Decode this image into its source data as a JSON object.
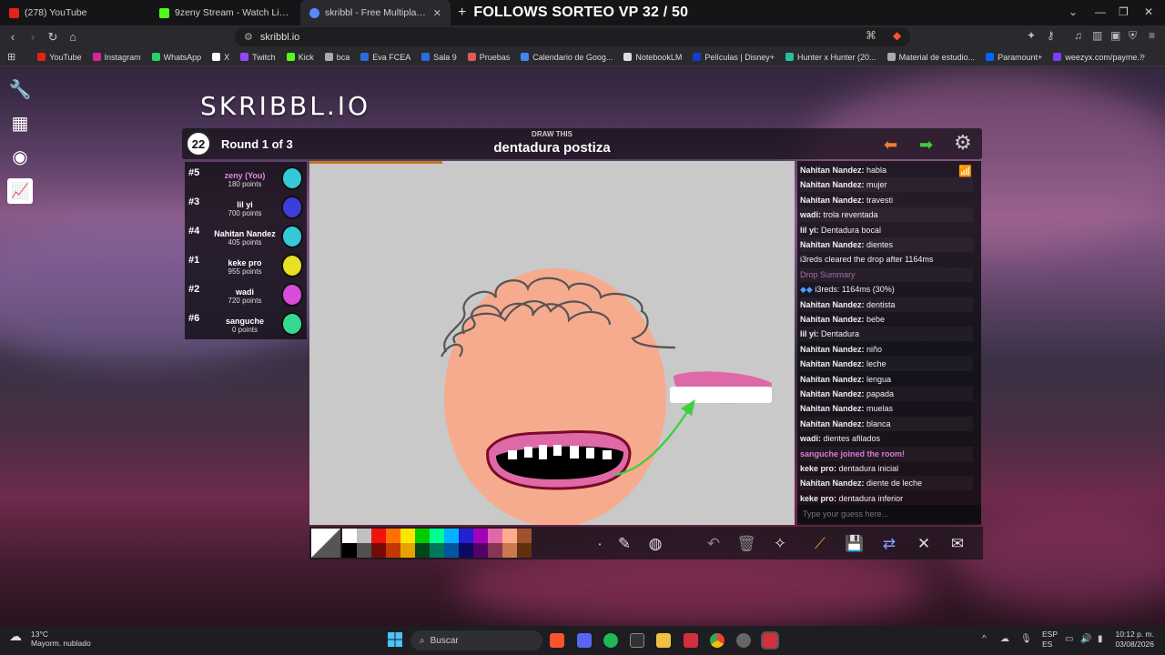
{
  "browser": {
    "tabs": [
      {
        "title": "(278) YouTube",
        "favicon_color": "#e62117"
      },
      {
        "title": "9zeny Stream - Watch Live on Kick",
        "favicon_color": "#53fc18"
      },
      {
        "title": "skribbl - Free Multiplayer Drawing",
        "favicon_color": "#5b87ff"
      }
    ],
    "overlay_title": "FOLLOWS SORTEO VP 32 / 50",
    "url": "skribbl.io",
    "bookmarks": [
      {
        "label": "YouTube",
        "color": "#e62117"
      },
      {
        "label": "Instagram",
        "color": "#d6249f"
      },
      {
        "label": "WhatsApp",
        "color": "#25d366"
      },
      {
        "label": "X",
        "color": "#ffffff"
      },
      {
        "label": "Twitch",
        "color": "#9146ff"
      },
      {
        "label": "Kick",
        "color": "#53fc18"
      },
      {
        "label": "bca",
        "color": "#aaaaaa"
      },
      {
        "label": "Eva FCEA",
        "color": "#2b6de0"
      },
      {
        "label": "Sala 9",
        "color": "#2b6de0"
      },
      {
        "label": "Pruebas",
        "color": "#e05a5a"
      },
      {
        "label": "Calendario de Goog...",
        "color": "#4285f4"
      },
      {
        "label": "NotebookLM",
        "color": "#dddddd"
      },
      {
        "label": "Películas | Disney+",
        "color": "#113ccf"
      },
      {
        "label": "Hunter x Hunter (20...",
        "color": "#1ec39e"
      },
      {
        "label": "Material de estudio...",
        "color": "#aaaaaa"
      },
      {
        "label": "Paramount+",
        "color": "#0064ff"
      },
      {
        "label": "weezyx.com/payme...",
        "color": "#7d3cff"
      }
    ]
  },
  "game": {
    "logo": "SKRIBBL.IO",
    "timer": "22",
    "round": "Round 1 of 3",
    "draw_this_label": "DRAW THIS",
    "word": "dentadura postiza",
    "players": [
      {
        "rank": "#5",
        "name": "zeny (You)",
        "points": "180 points",
        "you": true,
        "color": "#35c8d8"
      },
      {
        "rank": "#3",
        "name": "lil yi",
        "points": "700 points",
        "you": false,
        "color": "#3d3dd8"
      },
      {
        "rank": "#4",
        "name": "Nahitan Nandez",
        "points": "405 points",
        "you": false,
        "color": "#35c8d8"
      },
      {
        "rank": "#1",
        "name": "keke pro",
        "points": "955 points",
        "you": false,
        "color": "#e8e020"
      },
      {
        "rank": "#2",
        "name": "wadi",
        "points": "720 points",
        "you": false,
        "color": "#d84cd8"
      },
      {
        "rank": "#6",
        "name": "sanguche",
        "points": "0 points",
        "you": false,
        "color": "#35d890"
      }
    ],
    "chat": [
      {
        "user": "Nahitan Nandez",
        "text": "habla"
      },
      {
        "user": "Nahitan Nandez",
        "text": "mujer"
      },
      {
        "user": "Nahitan Nandez",
        "text": "travesti"
      },
      {
        "user": "wadi",
        "text": "trola reventada"
      },
      {
        "user": "lil yi",
        "text": "Dentadura bocal"
      },
      {
        "user": "Nahitan Nandez",
        "text": "dientes"
      },
      {
        "user": "",
        "text": "i3reds cleared the drop after 1164ms"
      },
      {
        "user": "",
        "text": "Drop Summary",
        "kind": "dim"
      },
      {
        "user": "",
        "text": "i3reds: 1164ms (30%)",
        "kind": "drop"
      },
      {
        "user": "Nahitan Nandez",
        "text": "dentista"
      },
      {
        "user": "Nahitan Nandez",
        "text": "bebe"
      },
      {
        "user": "lil yi",
        "text": "Dentadura"
      },
      {
        "user": "Nahitan Nandez",
        "text": "niño"
      },
      {
        "user": "Nahitan Nandez",
        "text": "leche"
      },
      {
        "user": "Nahitan Nandez",
        "text": "lengua"
      },
      {
        "user": "Nahitan Nandez",
        "text": "papada"
      },
      {
        "user": "Nahitan Nandez",
        "text": "muelas"
      },
      {
        "user": "Nahitan Nandez",
        "text": "blanca"
      },
      {
        "user": "wadi",
        "text": "dientes afilados"
      },
      {
        "user": "",
        "text": "sanguche joined the room!",
        "kind": "sys"
      },
      {
        "user": "keke pro",
        "text": "dentadura inicial"
      },
      {
        "user": "Nahitan Nandez",
        "text": "diente de leche"
      },
      {
        "user": "keke pro",
        "text": "dentadura inferior"
      }
    ],
    "chat_placeholder": "Type your guess here...",
    "palette_top": [
      "#ffffff",
      "#c1c1c1",
      "#ef130b",
      "#ff7100",
      "#ffe400",
      "#00cc00",
      "#00ff91",
      "#00b2ff",
      "#231fd3",
      "#a300ba",
      "#df69a7",
      "#ffac8e",
      "#a0522d"
    ],
    "palette_bottom": [
      "#000000",
      "#505050",
      "#740b07",
      "#c23800",
      "#e8a200",
      "#004619",
      "#00785d",
      "#00569e",
      "#0e0865",
      "#550069",
      "#873554",
      "#cc774d",
      "#63300d"
    ]
  },
  "taskbar": {
    "temperature": "13°C",
    "weather": "Mayorm. nublado",
    "search": "Buscar",
    "lang1": "ESP",
    "lang2": "ES",
    "time": "10:12 p. m.",
    "date": "03/08/2026"
  }
}
